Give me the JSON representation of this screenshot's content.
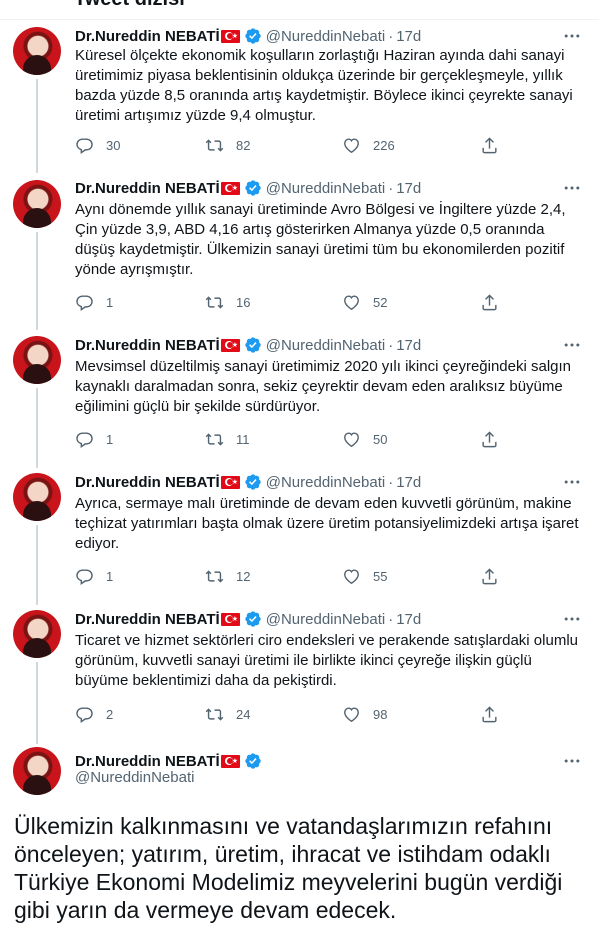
{
  "header": {
    "title": "Tweet dizisi"
  },
  "author": {
    "name": "Dr.Nureddin NEBATİ",
    "handle": "@NureddinNebati",
    "flag": "turkey-flag",
    "verified": true
  },
  "tweets": [
    {
      "time": "17d",
      "text": "Küresel ölçekte ekonomik koşulların zorlaştığı Haziran ayında dahi sanayi üretimimiz piyasa beklentisinin oldukça üzerinde bir gerçekleşmeyle, yıllık bazda yüzde 8,5 oranında artış kaydetmiştir. Böylece ikinci çeyrekte sanayi üretimi artışımız yüzde 9,4 olmuştur.",
      "replies": "30",
      "retweets": "82",
      "likes": "226"
    },
    {
      "time": "17d",
      "text": "Aynı dönemde yıllık sanayi üretiminde Avro Bölgesi ve İngiltere yüzde 2,4, Çin yüzde 3,9, ABD 4,16 artış gösterirken Almanya yüzde 0,5 oranında düşüş kaydetmiştir. Ülkemizin sanayi üretimi tüm bu ekonomilerden pozitif yönde ayrışmıştır.",
      "replies": "1",
      "retweets": "16",
      "likes": "52"
    },
    {
      "time": "17d",
      "text": "Mevsimsel düzeltilmiş sanayi üretimimiz 2020 yılı ikinci çeyreğindeki salgın kaynaklı daralmadan sonra, sekiz çeyrektir devam eden aralıksız büyüme eğilimini güçlü bir şekilde sürdürüyor.",
      "replies": "1",
      "retweets": "11",
      "likes": "50"
    },
    {
      "time": "17d",
      "text": "Ayrıca, sermaye malı üretiminde de devam eden kuvvetli görünüm, makine teçhizat yatırımları başta olmak üzere üretim potansiyelimizdeki artışa işaret ediyor.",
      "replies": "1",
      "retweets": "12",
      "likes": "55"
    },
    {
      "time": "17d",
      "text": "Ticaret ve hizmet sektörleri ciro endeksleri ve perakende satışlardaki olumlu görünüm, kuvvetli sanayi üretimi ile birlikte ikinci çeyreğe ilişkin güçlü büyüme beklentimizi daha da pekiştirdi.",
      "replies": "2",
      "retweets": "24",
      "likes": "98"
    }
  ],
  "final_tweet": {
    "text": "Ülkemizin kalkınmasını ve vatandaşlarımızın refahını önceleyen; yatırım, üretim, ihracat ve istihdam odaklı Türkiye Ekonomi Modelimiz meyvelerini bugün verdiği gibi yarın da vermeye devam edecek."
  },
  "icons": {
    "reply": "reply-icon",
    "retweet": "retweet-icon",
    "like": "heart-icon",
    "share": "share-icon",
    "more": "more-icon",
    "verified": "verified-icon"
  },
  "colors": {
    "text": "#0f1419",
    "muted": "#536471",
    "verified": "#1d9bf0",
    "flag": "#e30a17",
    "divider": "#eff3f4"
  }
}
